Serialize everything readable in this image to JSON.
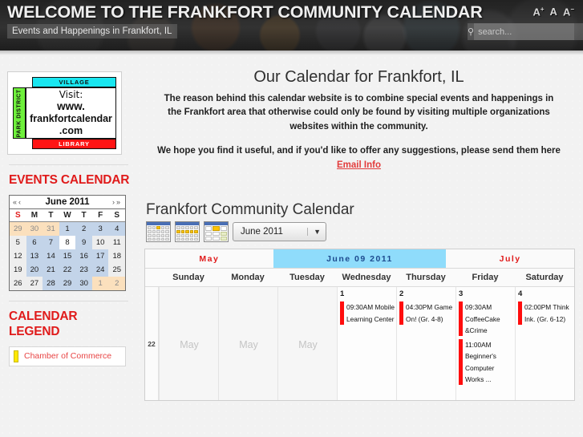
{
  "header": {
    "title": "WELCOME TO THE FRANKFORT COMMUNITY CALENDAR",
    "tagline": "Events and Happenings in Frankfort, IL",
    "font_increase": "A",
    "font_normal": "A",
    "font_decrease": "A",
    "search_placeholder": "search...",
    "search_value": ""
  },
  "sidebar": {
    "ad": {
      "village": "VILLAGE",
      "park_district": "PARK DISTRICT",
      "library": "LIBRARY",
      "line1": "Visit:",
      "line2": "www.",
      "line3": "frankfortcalendar",
      "line4": ".com"
    },
    "events_heading": "EVENTS CALENDAR",
    "mini_calendar": {
      "prev_year": "«",
      "prev_month": "‹",
      "title": "June 2011",
      "next_month": "›",
      "next_year": "»",
      "dow": [
        "S",
        "M",
        "T",
        "W",
        "T",
        "F",
        "S"
      ],
      "weeks": [
        [
          {
            "d": "29",
            "s": "orange"
          },
          {
            "d": "30",
            "s": "orange"
          },
          {
            "d": "31",
            "s": "orange"
          },
          {
            "d": "1",
            "s": "blue"
          },
          {
            "d": "2",
            "s": "blue"
          },
          {
            "d": "3",
            "s": "blue"
          },
          {
            "d": "4",
            "s": "blue"
          }
        ],
        [
          {
            "d": "5",
            "s": "pale"
          },
          {
            "d": "6",
            "s": "blue"
          },
          {
            "d": "7",
            "s": "blue"
          },
          {
            "d": "8",
            "s": "white"
          },
          {
            "d": "9",
            "s": "blue"
          },
          {
            "d": "10",
            "s": "pale"
          },
          {
            "d": "11",
            "s": "pale"
          }
        ],
        [
          {
            "d": "12",
            "s": "pale"
          },
          {
            "d": "13",
            "s": "blue"
          },
          {
            "d": "14",
            "s": "blue"
          },
          {
            "d": "15",
            "s": "blue"
          },
          {
            "d": "16",
            "s": "blue"
          },
          {
            "d": "17",
            "s": "blue"
          },
          {
            "d": "18",
            "s": "pale"
          }
        ],
        [
          {
            "d": "19",
            "s": "pale"
          },
          {
            "d": "20",
            "s": "blue"
          },
          {
            "d": "21",
            "s": "blue"
          },
          {
            "d": "22",
            "s": "blue"
          },
          {
            "d": "23",
            "s": "blue"
          },
          {
            "d": "24",
            "s": "blue"
          },
          {
            "d": "25",
            "s": "pale"
          }
        ],
        [
          {
            "d": "26",
            "s": "pale"
          },
          {
            "d": "27",
            "s": "pale"
          },
          {
            "d": "28",
            "s": "blue"
          },
          {
            "d": "29",
            "s": "blue"
          },
          {
            "d": "30",
            "s": "blue"
          },
          {
            "d": "1",
            "s": "orange"
          },
          {
            "d": "2",
            "s": "orange"
          }
        ]
      ]
    },
    "legend_heading": "CALENDAR LEGEND",
    "legend_items": [
      {
        "label": "Chamber of Commerce",
        "color": "#ffe800"
      }
    ]
  },
  "main": {
    "intro_title": "Our Calendar for Frankfort, IL",
    "intro_paragraph1": "The reason behind this calendar website is to combine special events and happenings in the Frankfort area that otherwise could only be found by visiting multiple organizations websites within the community.",
    "intro_paragraph2_before": "We hope you find it useful, and if you'd like to offer any suggestions, please send them here ",
    "intro_email_link": "Email Info",
    "calendar_title": "Frankfort Community Calendar",
    "tools": {
      "print": "print-icon",
      "email": "email-icon",
      "info": "info-icon"
    },
    "views": {
      "month": "month-view-icon",
      "week": "week-view-icon",
      "day": "day-view-icon"
    },
    "month_select_value": "June 2011",
    "month_nav": {
      "prev": "May",
      "current": "June 09 2011",
      "next": "July"
    },
    "day_headers": [
      "Sunday",
      "Monday",
      "Tuesday",
      "Wednesday",
      "Thursday",
      "Friday",
      "Saturday"
    ],
    "week_number": "22",
    "days": [
      {
        "label": "May",
        "other_month": true,
        "events": []
      },
      {
        "label": "May",
        "other_month": true,
        "events": []
      },
      {
        "label": "May",
        "other_month": true,
        "events": []
      },
      {
        "label": "1",
        "other_month": false,
        "events": [
          {
            "text": "09:30AM Mobile Learning Center",
            "color": "#ff0d0d"
          }
        ]
      },
      {
        "label": "2",
        "other_month": false,
        "events": [
          {
            "text": "04:30PM Game On! (Gr. 4-8)",
            "color": "#ff0d0d"
          }
        ]
      },
      {
        "label": "3",
        "other_month": false,
        "events": [
          {
            "text": "09:30AM CoffeeCake &Crime",
            "color": "#ff0d0d"
          },
          {
            "text": "11:00AM Beginner's Computer Works ...",
            "color": "#ff0d0d"
          }
        ]
      },
      {
        "label": "4",
        "other_month": false,
        "events": [
          {
            "text": "02:00PM Think Ink. (Gr. 6-12)",
            "color": "#ff0d0d"
          }
        ]
      }
    ]
  }
}
